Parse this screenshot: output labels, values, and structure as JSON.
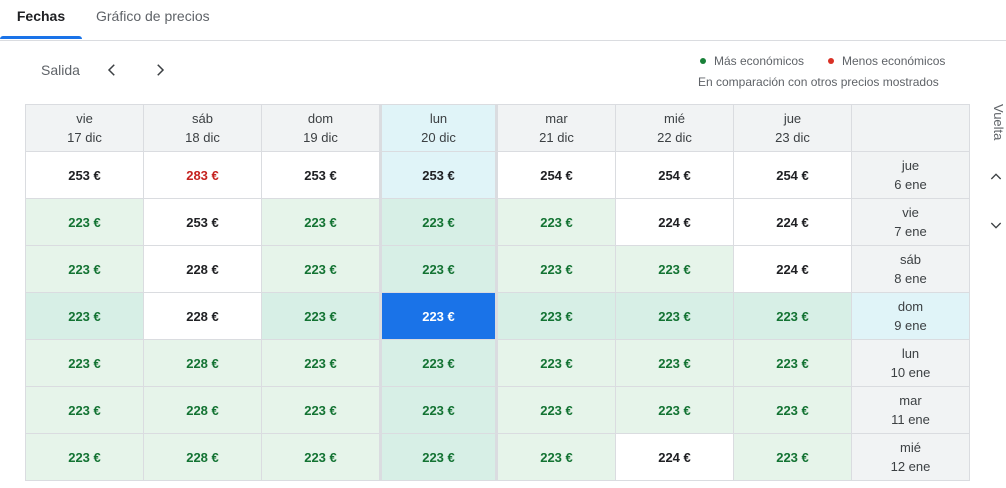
{
  "tabs": [
    {
      "label": "Fechas",
      "active": true
    },
    {
      "label": "Gráfico de precios",
      "active": false
    }
  ],
  "toolbar": {
    "salida_label": "Salida",
    "prev_icon": "chevron-left-icon",
    "next_icon": "chevron-right-icon"
  },
  "legend": {
    "cheap_label": "Más económicos",
    "cheap_color": "#188038",
    "expensive_label": "Menos económicos",
    "expensive_color": "#d93025",
    "comparison_note": "En comparación con otros precios mostrados"
  },
  "vuelta_label": "Vuelta",
  "columns": [
    {
      "day": "vie",
      "date": "17 dic"
    },
    {
      "day": "sáb",
      "date": "18 dic"
    },
    {
      "day": "dom",
      "date": "19 dic"
    },
    {
      "day": "lun",
      "date": "20 dic"
    },
    {
      "day": "mar",
      "date": "21 dic"
    },
    {
      "day": "mié",
      "date": "22 dic"
    },
    {
      "day": "jue",
      "date": "23 dic"
    }
  ],
  "rows": [
    {
      "day": "jue",
      "date": "6 ene",
      "prices": [
        "253 €",
        "283 €",
        "253 €",
        "253 €",
        "254 €",
        "254 €",
        "254 €"
      ],
      "levels": [
        "normal",
        "high",
        "normal",
        "normal",
        "normal",
        "normal",
        "normal"
      ]
    },
    {
      "day": "vie",
      "date": "7 ene",
      "prices": [
        "223 €",
        "253 €",
        "223 €",
        "223 €",
        "223 €",
        "224 €",
        "224 €"
      ],
      "levels": [
        "low",
        "normal",
        "low",
        "low",
        "low",
        "normal",
        "normal"
      ]
    },
    {
      "day": "sáb",
      "date": "8 ene",
      "prices": [
        "223 €",
        "228 €",
        "223 €",
        "223 €",
        "223 €",
        "223 €",
        "224 €"
      ],
      "levels": [
        "low",
        "normal",
        "low",
        "low",
        "low",
        "low",
        "normal"
      ]
    },
    {
      "day": "dom",
      "date": "9 ene",
      "prices": [
        "223 €",
        "228 €",
        "223 €",
        "223 €",
        "223 €",
        "223 €",
        "223 €"
      ],
      "levels": [
        "low",
        "normal",
        "low",
        "low",
        "low",
        "low",
        "low"
      ]
    },
    {
      "day": "lun",
      "date": "10 ene",
      "prices": [
        "223 €",
        "228 €",
        "223 €",
        "223 €",
        "223 €",
        "223 €",
        "223 €"
      ],
      "levels": [
        "low",
        "low",
        "low",
        "low",
        "low",
        "low",
        "low"
      ]
    },
    {
      "day": "mar",
      "date": "11 ene",
      "prices": [
        "223 €",
        "228 €",
        "223 €",
        "223 €",
        "223 €",
        "223 €",
        "223 €"
      ],
      "levels": [
        "low",
        "low",
        "low",
        "low",
        "low",
        "low",
        "low"
      ]
    },
    {
      "day": "mié",
      "date": "12 ene",
      "prices": [
        "223 €",
        "228 €",
        "223 €",
        "223 €",
        "223 €",
        "224 €",
        "223 €"
      ],
      "levels": [
        "low",
        "low",
        "low",
        "low",
        "low",
        "normal",
        "low"
      ]
    }
  ],
  "selection": {
    "column_index": 3,
    "row_index": 3
  }
}
